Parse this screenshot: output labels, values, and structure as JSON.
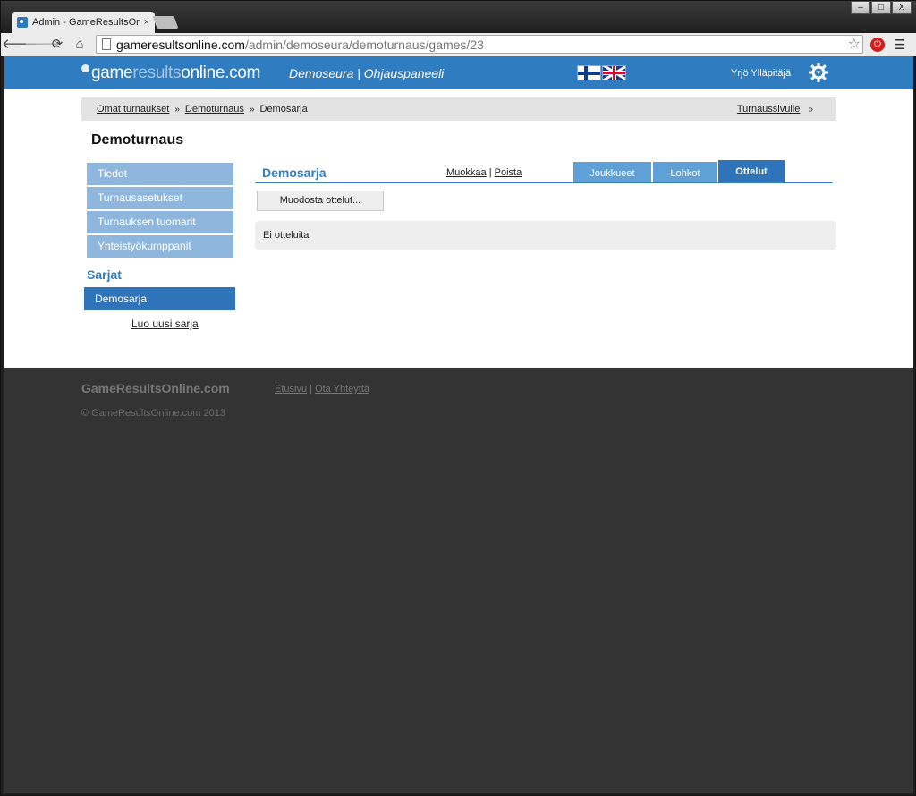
{
  "browser": {
    "tab_title": "Admin - GameResultsOnli",
    "tab_close": "×",
    "url_host": "gameresultsonline.com",
    "url_path": "/admin/demoseura/demoturnaus/games/23",
    "win_min": "–",
    "win_max": "□",
    "win_close": "X"
  },
  "header": {
    "logo_a": "game",
    "logo_b": "results",
    "logo_c": "online.com",
    "club": "Demoseura | Ohjauspaneeli",
    "user": "Yrjö Ylläpitäjä"
  },
  "breadcrumb": {
    "items": [
      "Omat turnaukset",
      "Demoturnaus",
      "Demosarja"
    ],
    "right": "Turnaussivulle",
    "separator": "»"
  },
  "tournament": {
    "title": "Demoturnaus"
  },
  "sidebar": {
    "items": [
      "Tiedot",
      "Turnausasetukset",
      "Turnauksen tuomarit",
      "Yhteistyökumppanit"
    ],
    "series_heading": "Sarjat",
    "series": [
      "Demosarja"
    ],
    "new_series": "Luo uusi sarja"
  },
  "series": {
    "title": "Demosarja",
    "edit": "Muokkaa",
    "delete": "Poista",
    "action_sep": "|",
    "tabs": [
      "Joukkueet",
      "Lohkot",
      "Ottelut"
    ],
    "active_tab": "Ottelut",
    "generate_button": "Muodosta ottelut...",
    "empty_message": "Ei otteluita"
  },
  "footer": {
    "brand": "GameResultsOnline.com",
    "home": "Etusivu",
    "contact": "Ota Yhteyttä",
    "link_sep": "|",
    "copyright": "© GameResultsOnline.com 2013"
  },
  "colors": {
    "brand_blue": "#2f7cc0",
    "sidebar_light": "#8fb7dd",
    "tab_light": "#5fa0d7",
    "footer_bg": "#333333"
  }
}
